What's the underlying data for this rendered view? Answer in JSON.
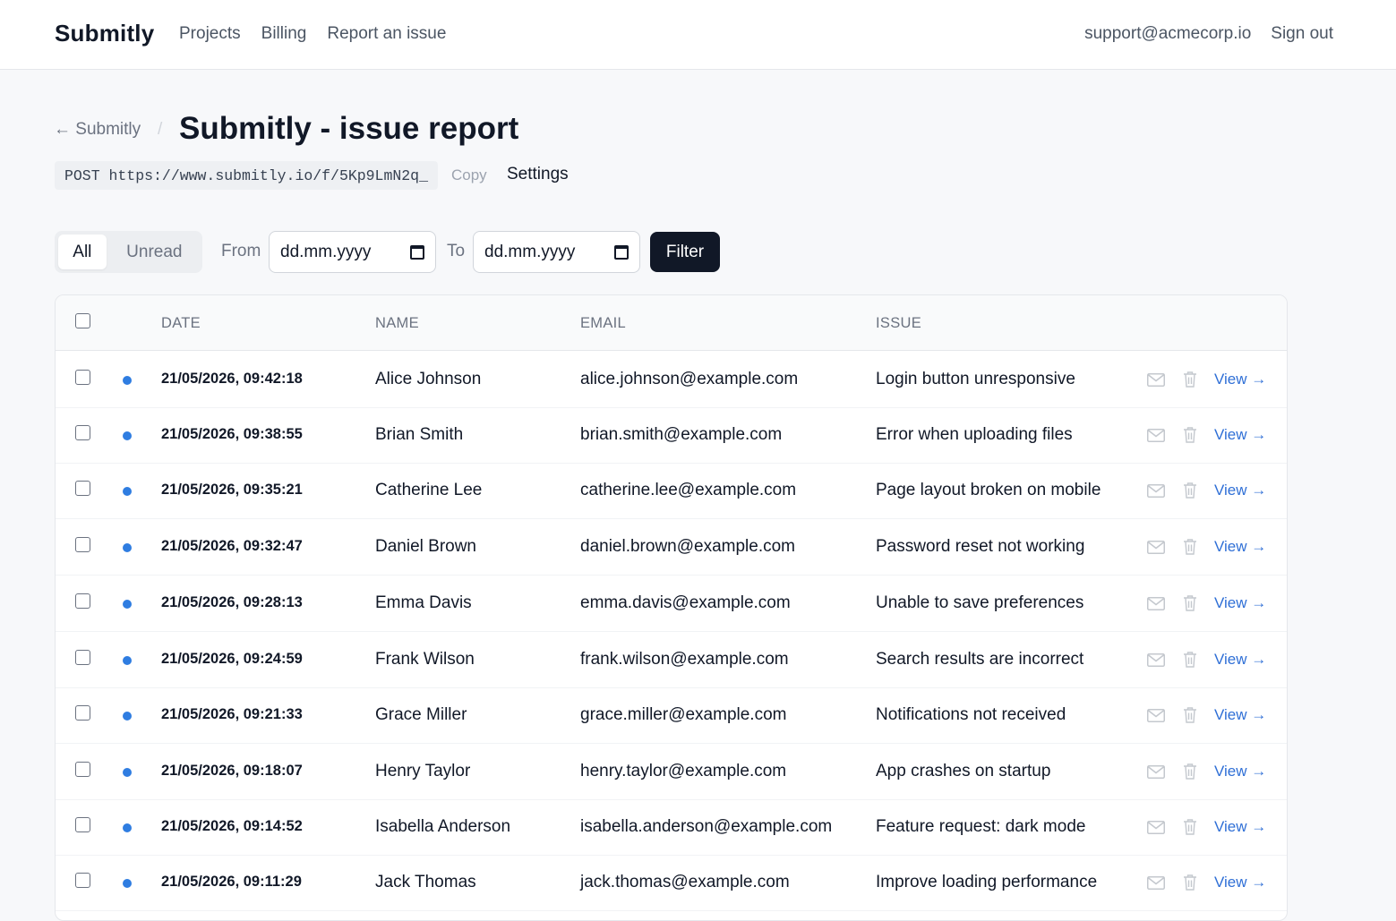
{
  "nav": {
    "brand": "Submitly",
    "links": [
      "Projects",
      "Billing",
      "Report an issue"
    ],
    "email": "support@acmecorp.io",
    "signout": "Sign out"
  },
  "header": {
    "back_label": "← Submitly",
    "separator": "/",
    "title": "Submitly - issue report",
    "endpoint": "POST https://www.submitly.io/f/5Kp9LmN2q_",
    "copy_label": "Copy",
    "settings_label": "Settings"
  },
  "filters": {
    "tab_all": "All",
    "tab_unread": "Unread",
    "from_label": "From",
    "from_value": "dd.mm.yyyy",
    "to_label": "To",
    "to_value": "dd.mm.yyyy",
    "filter_label": "Filter"
  },
  "table": {
    "headers": [
      "DATE",
      "NAME",
      "EMAIL",
      "ISSUE"
    ],
    "view_label": "View →",
    "unread_color": "#2f7de1",
    "rows": [
      {
        "date": "21/05/2026, 09:42:18",
        "name": "Alice Johnson",
        "email": "alice.johnson@example.com",
        "issue": "Login button unresponsive"
      },
      {
        "date": "21/05/2026, 09:38:55",
        "name": "Brian Smith",
        "email": "brian.smith@example.com",
        "issue": "Error when uploading files"
      },
      {
        "date": "21/05/2026, 09:35:21",
        "name": "Catherine Lee",
        "email": "catherine.lee@example.com",
        "issue": "Page layout broken on mobile"
      },
      {
        "date": "21/05/2026, 09:32:47",
        "name": "Daniel Brown",
        "email": "daniel.brown@example.com",
        "issue": "Password reset not working"
      },
      {
        "date": "21/05/2026, 09:28:13",
        "name": "Emma Davis",
        "email": "emma.davis@example.com",
        "issue": "Unable to save preferences"
      },
      {
        "date": "21/05/2026, 09:24:59",
        "name": "Frank Wilson",
        "email": "frank.wilson@example.com",
        "issue": "Search results are incorrect"
      },
      {
        "date": "21/05/2026, 09:21:33",
        "name": "Grace Miller",
        "email": "grace.miller@example.com",
        "issue": "Notifications not received"
      },
      {
        "date": "21/05/2026, 09:18:07",
        "name": "Henry Taylor",
        "email": "henry.taylor@example.com",
        "issue": "App crashes on startup"
      },
      {
        "date": "21/05/2026, 09:14:52",
        "name": "Isabella Anderson",
        "email": "isabella.anderson@example.com",
        "issue": "Feature request: dark mode"
      },
      {
        "date": "21/05/2026, 09:11:29",
        "name": "Jack Thomas",
        "email": "jack.thomas@example.com",
        "issue": "Improve loading performance"
      }
    ]
  }
}
